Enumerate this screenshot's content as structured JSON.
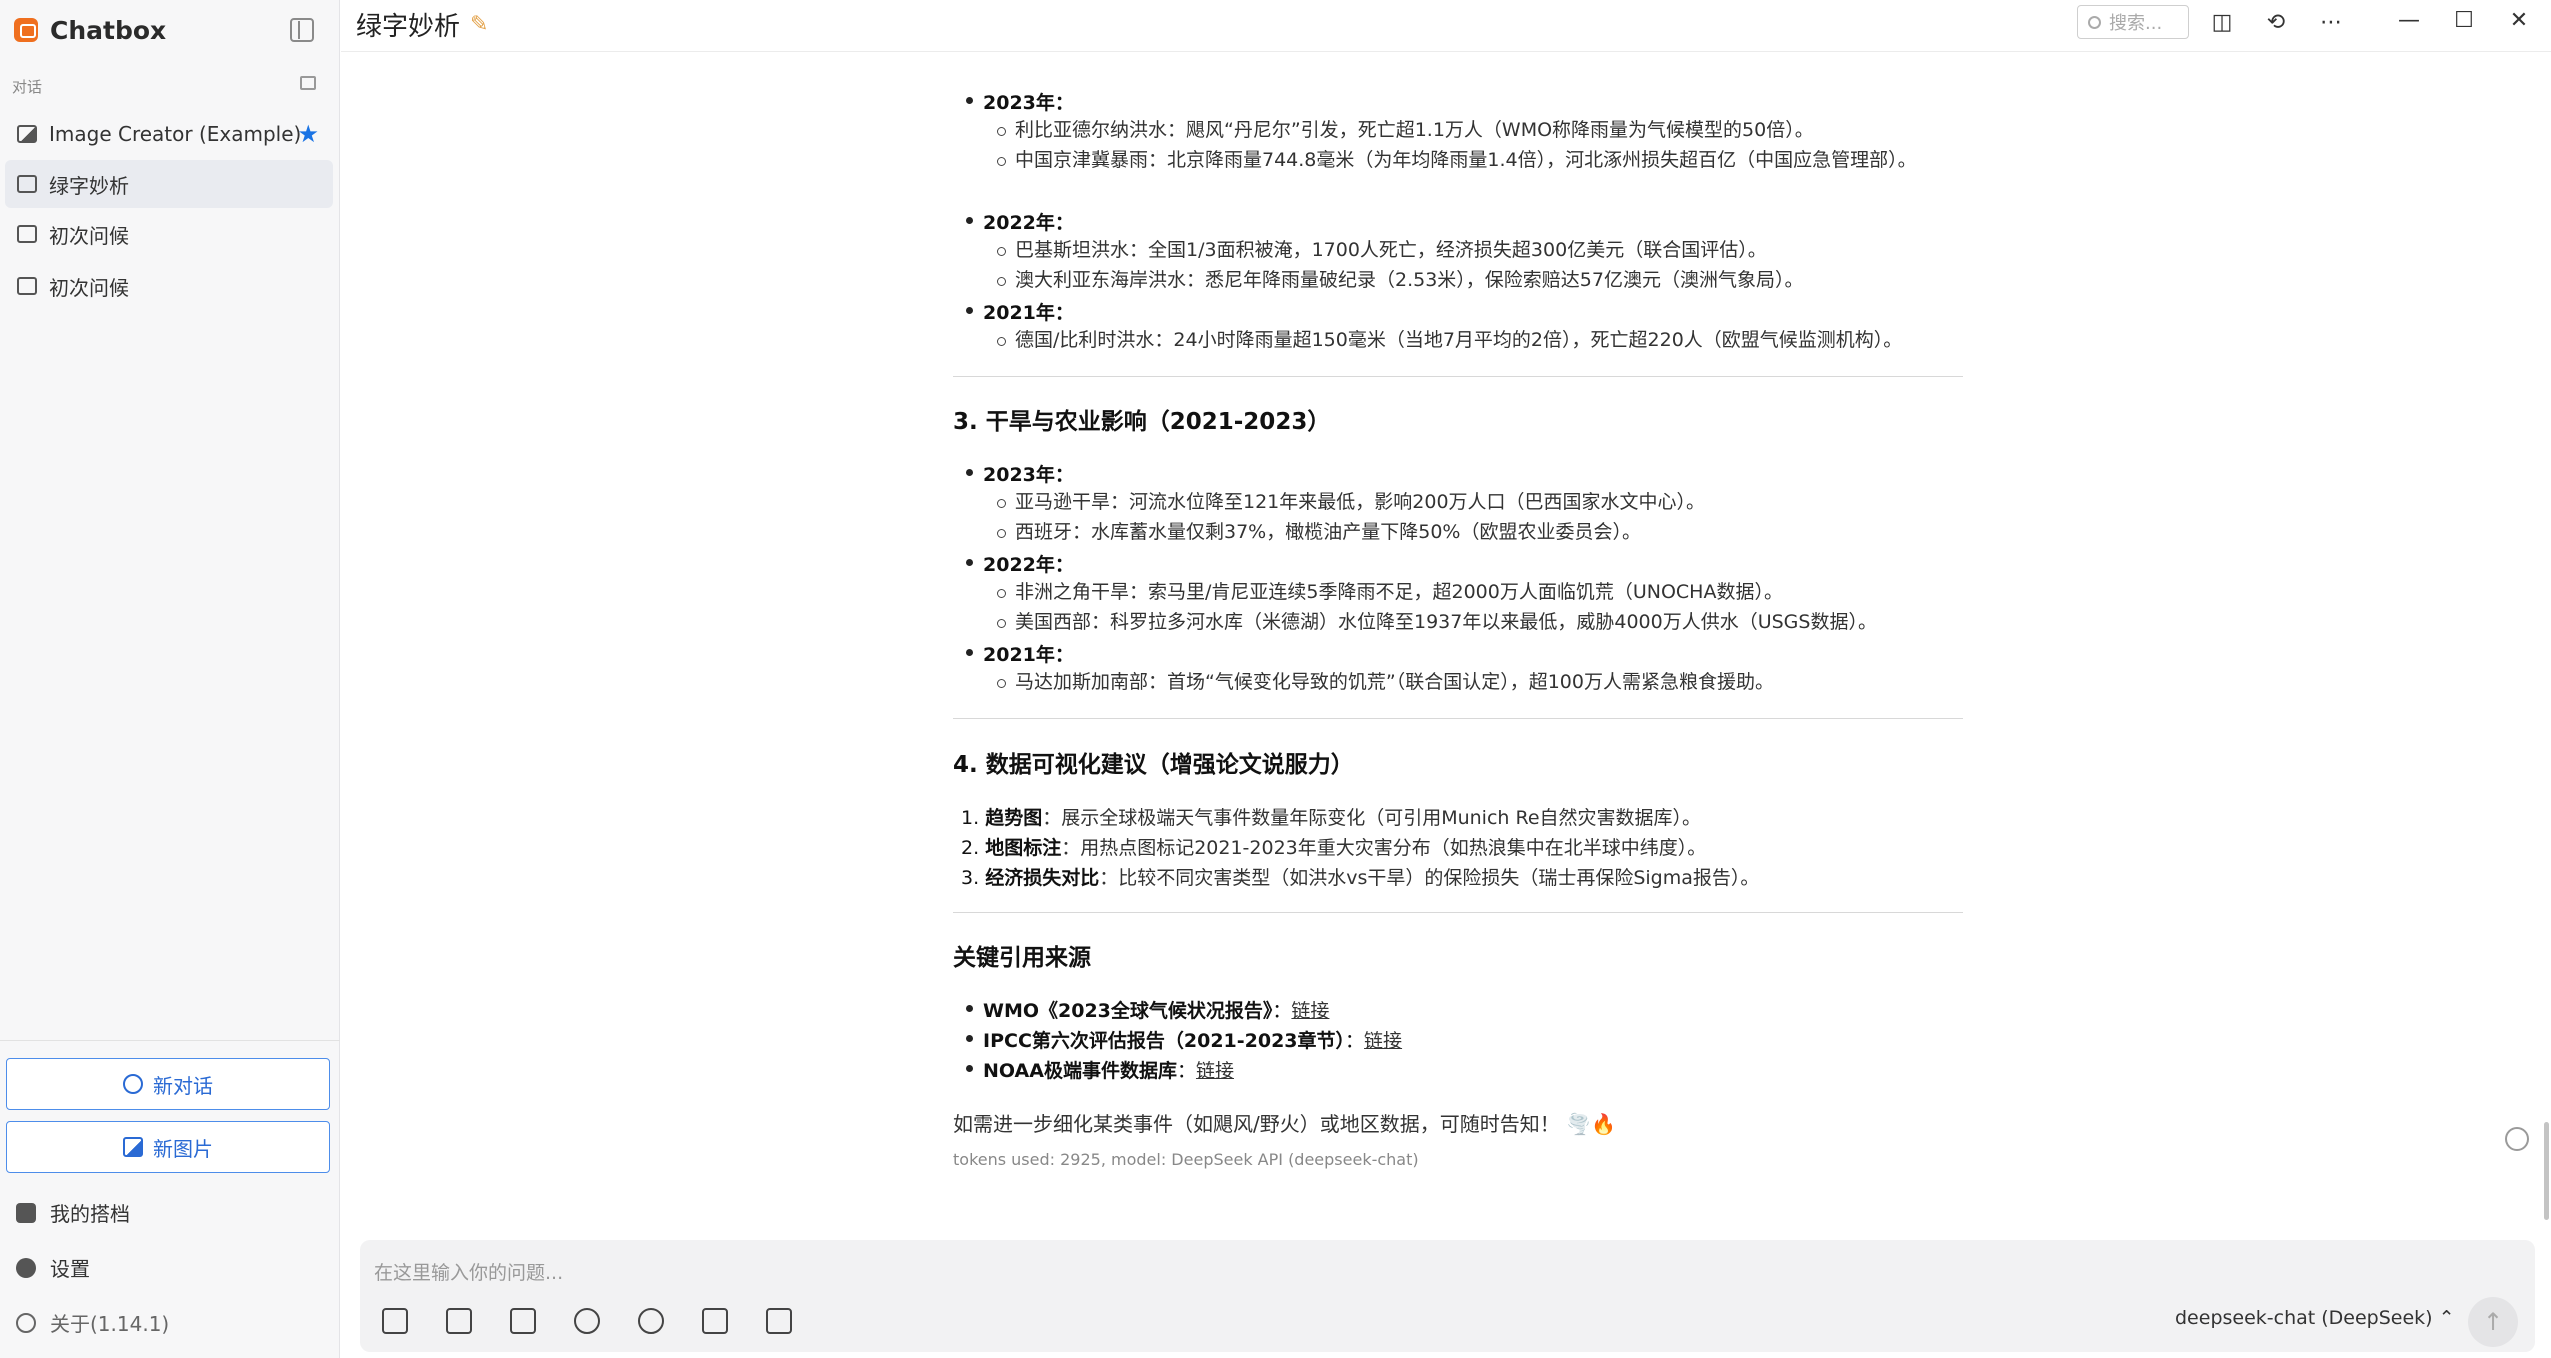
{
  "app": {
    "name": "Chatbox"
  },
  "sidebar": {
    "section_label": "对话",
    "conversations": [
      {
        "label": "Image Creator (Example)",
        "starred": true
      },
      {
        "label": "绿字妙析",
        "active": true
      },
      {
        "label": "初次问候"
      },
      {
        "label": "初次问候"
      }
    ],
    "new_chat_label": "新对话",
    "new_image_label": "新图片",
    "partners_label": "我的搭档",
    "settings_label": "设置",
    "about_label": "关于(1.14.1)"
  },
  "header": {
    "title": "绿字妙析",
    "search_placeholder": "搜索..."
  },
  "message": {
    "s2_items": [
      {
        "year": "2023年：",
        "entries": [
          "利比亚德尔纳洪水：飓风“丹尼尔”引发，死亡超1.1万人（WMO称降雨量为气候模型的50倍）。",
          "中国京津冀暴雨：北京降雨量744.8毫米（为年均降雨量1.4倍），河北涿州损失超百亿（中国应急管理部）。"
        ]
      },
      {
        "year": "2022年：",
        "entries": [
          "巴基斯坦洪水：全国1/3面积被淹，1700人死亡，经济损失超300亿美元（联合国评估）。",
          "澳大利亚东海岸洪水：悉尼年降雨量破纪录（2.53米），保险索赔达57亿澳元（澳洲气象局）。"
        ]
      },
      {
        "year": "2021年：",
        "entries": [
          "德国/比利时洪水：24小时降雨量超150毫米（当地7月平均的2倍），死亡超220人（欧盟气候监测机构）。"
        ]
      }
    ],
    "s3_title": "3. 干旱与农业影响（2021-2023）",
    "s3_items": [
      {
        "year": "2023年：",
        "entries": [
          "亚马逊干旱：河流水位降至121年来最低，影响200万人口（巴西国家水文中心）。",
          "西班牙：水库蓄水量仅剩37%，橄榄油产量下降50%（欧盟农业委员会）。"
        ]
      },
      {
        "year": "2022年：",
        "entries": [
          "非洲之角干旱：索马里/肯尼亚连续5季降雨不足，超2000万人面临饥荒（UNOCHA数据）。",
          "美国西部：科罗拉多河水库（米德湖）水位降至1937年以来最低，威胁4000万人供水（USGS数据）。"
        ]
      },
      {
        "year": "2021年：",
        "entries": [
          "马达加斯加南部：首场“气候变化导致的饥荒”（联合国认定），超100万人需紧急粮食援助。"
        ]
      }
    ],
    "s4_title": "4. 数据可视化建议（增强论文说服力）",
    "s4_items": [
      {
        "n": "1.",
        "label": "趋势图",
        "text": "：展示全球极端天气事件数量年际变化（可引用Munich Re自然灾害数据库）。"
      },
      {
        "n": "2.",
        "label": "地图标注",
        "text": "：用热点图标记2021-2023年重大灾害分布（如热浪集中在北半球中纬度）。"
      },
      {
        "n": "3.",
        "label": "经济损失对比",
        "text": "：比较不同灾害类型（如洪水vs干旱）的保险损失（瑞士再保险Sigma报告）。"
      }
    ],
    "s5_title": "关键引用来源",
    "sources": [
      {
        "label": "WMO《2023全球气候状况报告》",
        "sep": "：",
        "link": "链接"
      },
      {
        "label": "IPCC第六次评估报告（2021-2023章节）",
        "sep": "：",
        "link": "链接"
      },
      {
        "label": "NOAA极端事件数据库",
        "sep": "：",
        "link": "链接"
      }
    ],
    "closing": "如需进一步细化某类事件（如飓风/野火）或地区数据，可随时告知！ 🌪️🔥",
    "meta": "tokens used: 2925, model: DeepSeek API (deepseek-chat)"
  },
  "composer": {
    "placeholder": "在这里输入你的问题...",
    "model_label": "deepseek-chat (DeepSeek) ⌃"
  },
  "colors": {
    "accent": "#2a6ad4",
    "brand": "#ef6f1f",
    "star": "#1b74e4"
  }
}
